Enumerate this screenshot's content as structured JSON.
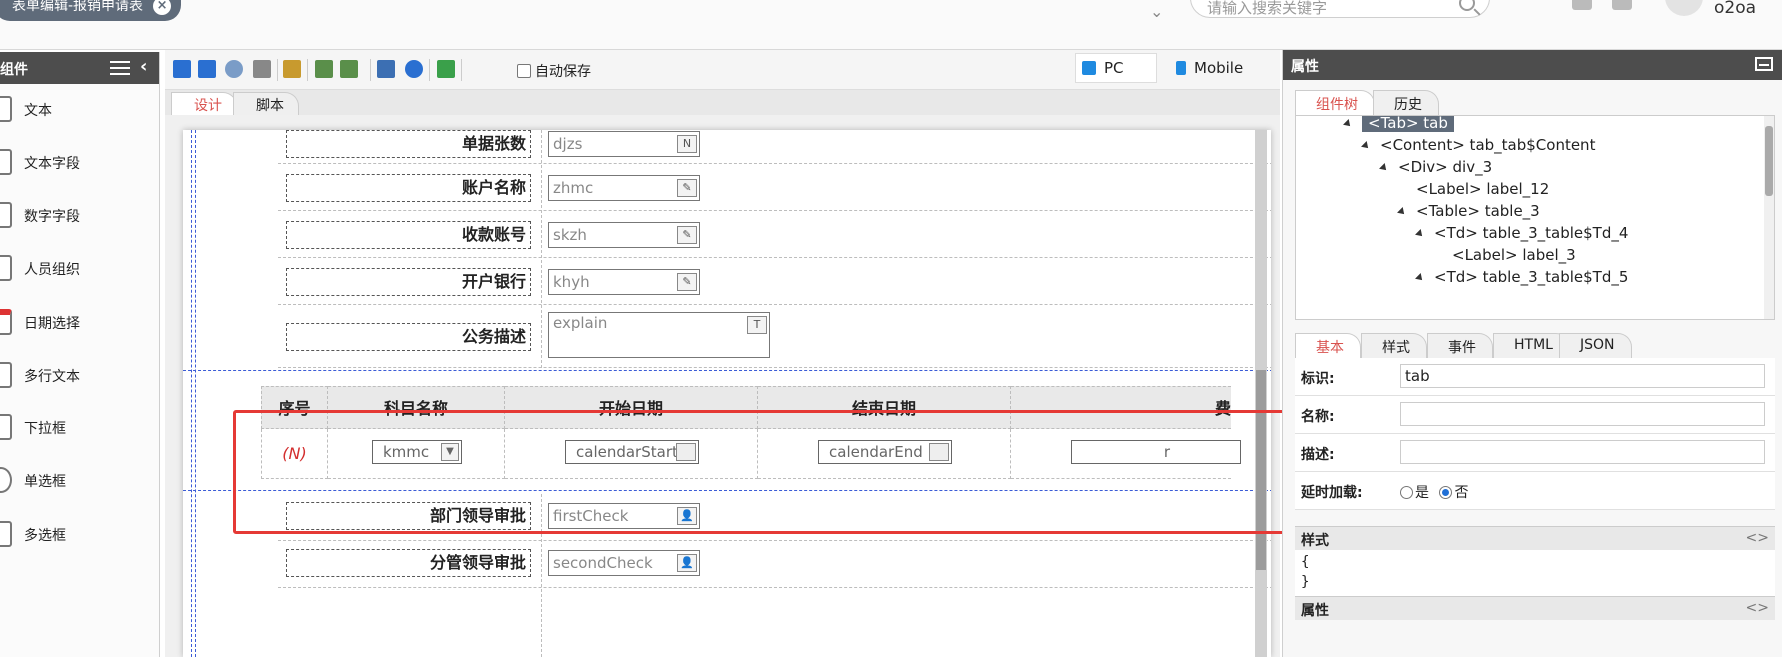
{
  "header": {
    "form_tab_title": "表单编辑-报销申请表",
    "search_placeholder": "请输入搜索关键字",
    "username": "o2oa"
  },
  "left_panel": {
    "title": "组件",
    "components": [
      {
        "label": "文本",
        "icon": "text-icon"
      },
      {
        "label": "文本字段",
        "icon": "textfield-icon"
      },
      {
        "label": "数字字段",
        "icon": "number-field-icon"
      },
      {
        "label": "人员组织",
        "icon": "org-icon"
      },
      {
        "label": "日期选择",
        "icon": "calendar-icon"
      },
      {
        "label": "多行文本",
        "icon": "textarea-icon"
      },
      {
        "label": "下拉框",
        "icon": "select-icon"
      },
      {
        "label": "单选框",
        "icon": "radio-icon"
      },
      {
        "label": "多选框",
        "icon": "checkbox-icon"
      }
    ]
  },
  "toolbar": {
    "autosave_label": "自动保存",
    "pc_label": "PC",
    "mobile_label": "Mobile"
  },
  "designer_tabs": [
    "设计",
    "脚本"
  ],
  "form_rows": [
    {
      "label": "单据张数",
      "value": "djzs",
      "icon": "number-field-icon"
    },
    {
      "label": "账户名称",
      "value": "zhmc",
      "icon": "edit-field-icon"
    },
    {
      "label": "收款账号",
      "value": "skzh",
      "icon": "edit-field-icon"
    },
    {
      "label": "开户银行",
      "value": "khyh",
      "icon": "edit-field-icon"
    },
    {
      "label": "公务描述",
      "value": "explain",
      "icon": "textarea-icon"
    }
  ],
  "detail_table": {
    "headers": [
      "序号",
      "科目名称",
      "开始日期",
      "结束日期",
      "费"
    ],
    "row": {
      "index": "(N)",
      "subject": "kmmc",
      "start": "calendarStart",
      "end": "calendarEnd",
      "fee_partial": "r"
    }
  },
  "form_rows_after": [
    {
      "label": "部门领导审批",
      "value": "firstCheck",
      "icon": "person-icon"
    },
    {
      "label": "分管领导审批",
      "value": "secondCheck",
      "icon": "person-icon"
    }
  ],
  "right_panel": {
    "title": "属性",
    "tree_tabs": [
      "组件树",
      "历史"
    ],
    "tree": [
      "<Tab> tab",
      "<Content> tab_tab$Content",
      "<Div> div_3",
      "<Label> label_12",
      "<Table> table_3",
      "<Td> table_3_table$Td_4",
      "<Label> label_3",
      "<Td> table_3_table$Td_5"
    ],
    "prop_tabs": [
      "基本",
      "样式",
      "事件",
      "HTML",
      "JSON"
    ],
    "fields": {
      "id_label": "标识:",
      "id_value": "tab",
      "name_label": "名称:",
      "desc_label": "描述:",
      "lazy_label": "延时加载:",
      "yes": "是",
      "no": "否"
    },
    "style_section": "样式",
    "style_code": [
      "{",
      "}"
    ],
    "attr_section": "属性",
    "section_toggle": "<>"
  },
  "colors": {
    "accent_red": "#e53935",
    "tab_active": "#d9534f",
    "dark_header": "#4d4d4d"
  }
}
